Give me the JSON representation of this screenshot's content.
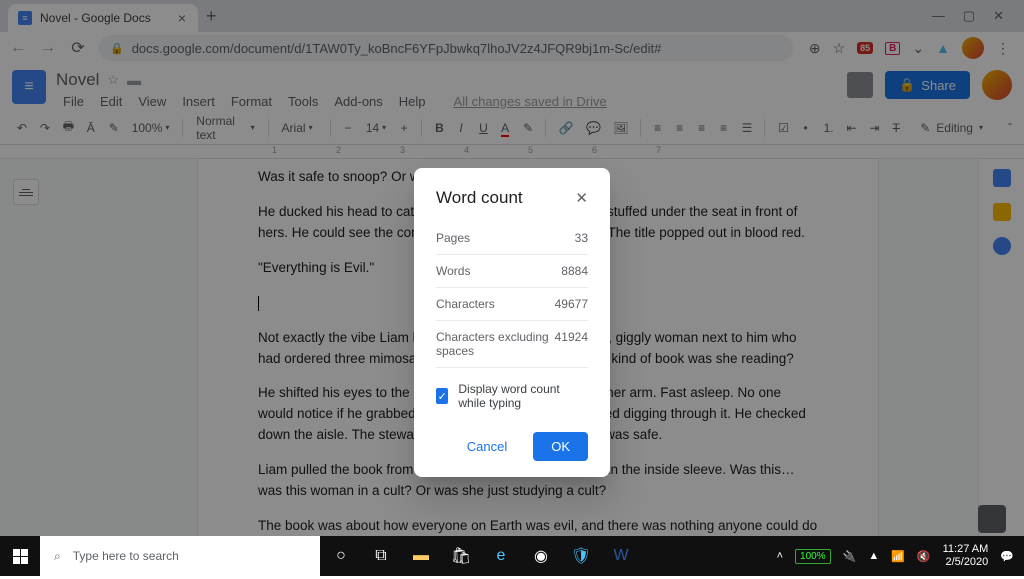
{
  "browser": {
    "tab_title": "Novel - Google Docs",
    "url": "docs.google.com/document/d/1TAW0Ty_koBncF6YFpJbwkq7lhoJV2z4JFQR9bj1m-Sc/edit#"
  },
  "docs": {
    "title": "Novel",
    "menu": [
      "File",
      "Edit",
      "View",
      "Insert",
      "Format",
      "Tools",
      "Add-ons",
      "Help"
    ],
    "saved": "All changes saved in Drive",
    "share": "Share",
    "editing": "Editing",
    "toolbar": {
      "zoom": "100%",
      "style": "Normal text",
      "font": "Arial",
      "size": "14"
    },
    "ruler": [
      "1",
      "2",
      "3",
      "4",
      "5",
      "6",
      "7"
    ],
    "body": {
      "p1": "Was it safe to snoop? Or would she be back any minute?",
      "p2": "He ducked his head to catch sight of her monstrous purse stuffed under the seat in front of hers. He could see the corner of the red book sticking out. The title popped out in blood red.",
      "p3": "\"Everything is Evil.\"",
      "p4": "Not exactly the vibe Liam had gotten from the sweet, perky, giggly woman next to him who had ordered three mimosas from the flight attendant. What kind of book was she reading?",
      "p5": "He shifted his eyes to the back of the plane. He could see her arm. Fast asleep. No one would notice if he grabbed the book. He reached and started digging through it. He checked down the aisle. The stewardess was nowhere in sight. He was safe.",
      "p6": "Liam pulled the book from her bag. There was a pamphlet in the inside sleeve. Was this… was this woman in a cult? Or was she just studying a cult?",
      "p7": "The book was about how everyone on Earth was evil, and there was nothing anyone could do to change it. But there were a select few who had been chosen by the universe to be good. And those good people had a responsibility."
    }
  },
  "word_count": {
    "title": "Word count",
    "rows": [
      {
        "label": "Pages",
        "value": "33"
      },
      {
        "label": "Words",
        "value": "8884"
      },
      {
        "label": "Characters",
        "value": "49677"
      },
      {
        "label": "Characters excluding spaces",
        "value": "41924"
      }
    ],
    "checkbox_label": "Display word count while typing",
    "checkbox_checked": true,
    "cancel": "Cancel",
    "ok": "OK"
  },
  "taskbar": {
    "search_placeholder": "Type here to search",
    "battery": "100%",
    "time": "11:27 AM",
    "date": "2/5/2020"
  }
}
